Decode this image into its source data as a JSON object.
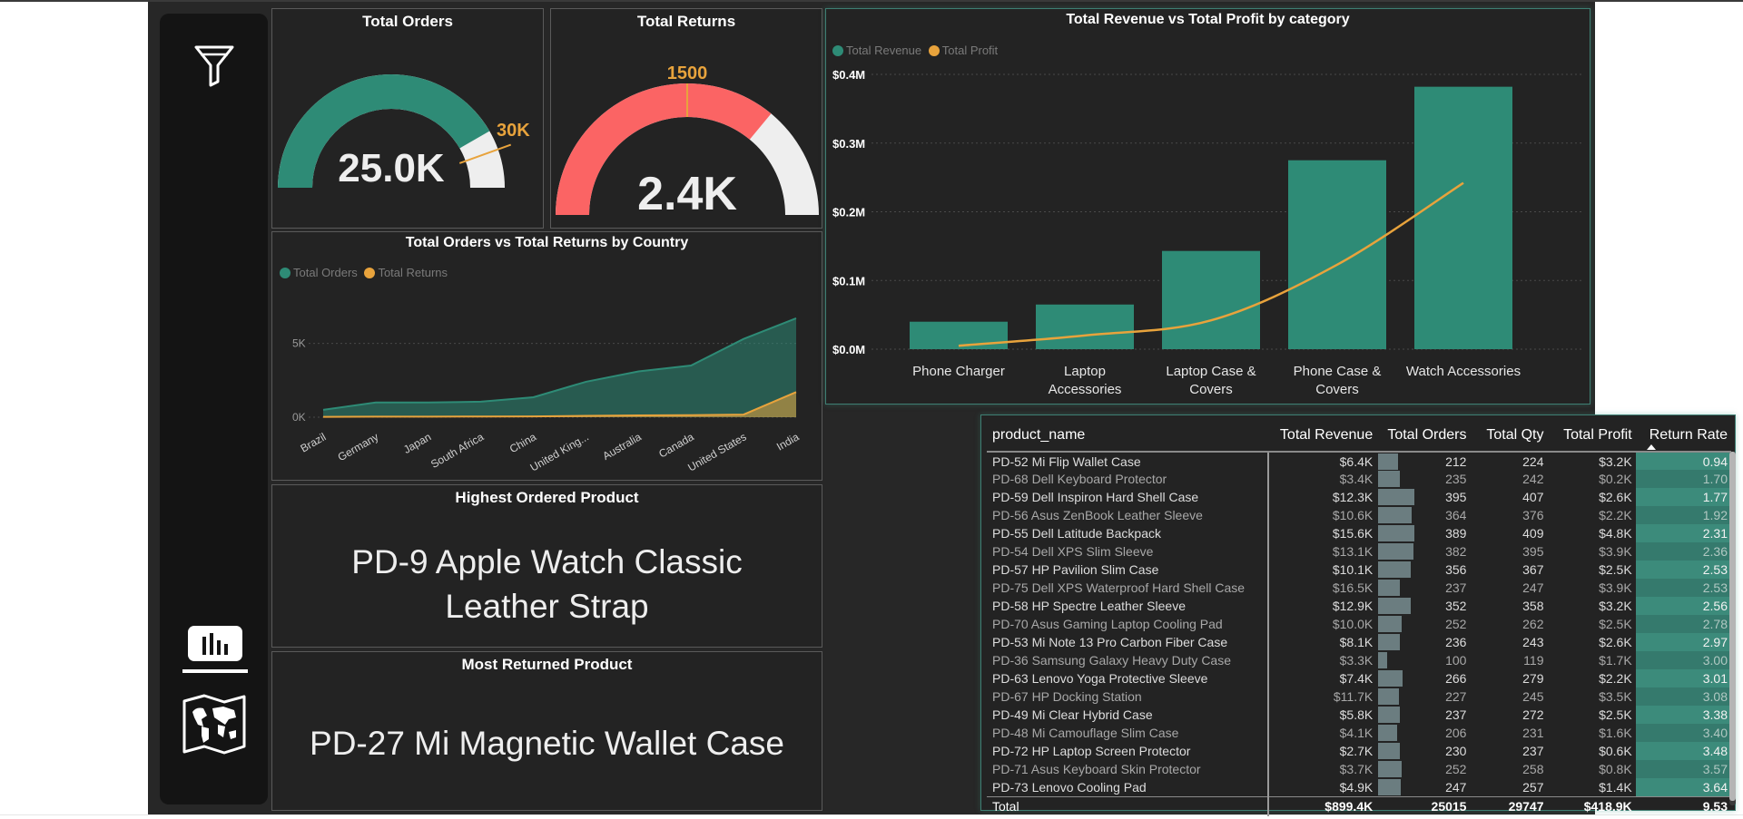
{
  "cards": {
    "total_orders": {
      "title": "Total Orders",
      "value": "25.0K",
      "target_label": "30K",
      "fraction": 0.8333,
      "target_fraction": 1.0
    },
    "total_returns": {
      "title": "Total Returns",
      "value": "2.4K",
      "target_label": "1500",
      "fraction": 0.72,
      "target_fraction": 0.5
    }
  },
  "country_chart": {
    "title": "Total Orders vs Total Returns by Country",
    "legend": [
      "Total Orders",
      "Total Returns"
    ],
    "colors": {
      "orders": "#2e8b76",
      "returns": "#e8a33c"
    },
    "y_ticks": [
      "5K",
      "0K"
    ],
    "y_tick_values": [
      5000,
      0
    ],
    "ylim": [
      0,
      7000
    ]
  },
  "category_chart": {
    "title": "Total Revenue vs Total Profit by category",
    "legend": [
      "Total Revenue",
      "Total Profit"
    ],
    "colors": {
      "revenue": "#2e8b76",
      "profit": "#e8a33c"
    },
    "y_ticks": [
      "$0.4M",
      "$0.3M",
      "$0.2M",
      "$0.1M",
      "$0.0M"
    ],
    "y_tick_values": [
      400000,
      300000,
      200000,
      100000,
      0
    ],
    "ylim": [
      0,
      400000
    ]
  },
  "chart_data": [
    {
      "type": "area",
      "title": "Total Orders vs Total Returns by Country",
      "xlabel": "",
      "ylabel": "",
      "categories": [
        "Brazil",
        "Germany",
        "Japan",
        "South Africa",
        "China",
        "United King...",
        "Australia",
        "Canada",
        "United States",
        "India"
      ],
      "series": [
        {
          "name": "Total Orders",
          "values": [
            500,
            1000,
            1000,
            1050,
            1350,
            2400,
            3100,
            3500,
            5300,
            6700
          ]
        },
        {
          "name": "Total Returns",
          "values": [
            20,
            40,
            40,
            45,
            55,
            90,
            120,
            140,
            180,
            1700
          ]
        }
      ],
      "ylim": [
        0,
        7000
      ],
      "grid": true,
      "legend_position": "top-left"
    },
    {
      "type": "bar",
      "title": "Total Revenue vs Total Profit by category",
      "xlabel": "",
      "ylabel": "",
      "categories": [
        "Phone Charger",
        "Laptop Accessories",
        "Laptop Case & Covers",
        "Phone Case & Covers",
        "Watch Accessories"
      ],
      "series": [
        {
          "name": "Total Revenue",
          "type": "bar",
          "values": [
            40000,
            65000,
            143000,
            275000,
            382000
          ]
        },
        {
          "name": "Total Profit",
          "type": "line",
          "values": [
            5000,
            20000,
            42000,
            123000,
            242000
          ]
        }
      ],
      "ylim": [
        0,
        400000
      ],
      "grid": true,
      "legend_position": "top-left"
    }
  ],
  "highest_product": {
    "title": "Highest Ordered Product",
    "line1": "PD-9  Apple Watch Classic",
    "line2": "Leather Strap"
  },
  "most_returned": {
    "title": "Most Returned Product",
    "text": "PD-27  Mi Magnetic Wallet Case"
  },
  "table": {
    "columns": [
      "product_name",
      "Total Revenue",
      "Total Orders",
      "Total Qty",
      "Total Profit",
      "Return Rate"
    ],
    "sorted_column": "Return Rate",
    "max_orders": 395,
    "rows": [
      [
        "PD-52  Mi Flip Wallet Case",
        "$6.4K",
        "212",
        "224",
        "$3.2K",
        "0.94"
      ],
      [
        "PD-68  Dell Keyboard Protector",
        "$3.4K",
        "235",
        "242",
        "$0.2K",
        "1.70"
      ],
      [
        "PD-59  Dell Inspiron Hard Shell Case",
        "$12.3K",
        "395",
        "407",
        "$2.6K",
        "1.77"
      ],
      [
        "PD-56  Asus ZenBook Leather Sleeve",
        "$10.6K",
        "364",
        "376",
        "$2.2K",
        "1.92"
      ],
      [
        "PD-55  Dell Latitude Backpack",
        "$15.6K",
        "389",
        "409",
        "$4.8K",
        "2.31"
      ],
      [
        "PD-54  Dell XPS Slim Sleeve",
        "$13.1K",
        "382",
        "395",
        "$3.9K",
        "2.36"
      ],
      [
        "PD-57  HP Pavilion Slim Case",
        "$10.1K",
        "356",
        "367",
        "$2.5K",
        "2.53"
      ],
      [
        "PD-75  Dell XPS Waterproof Hard Shell Case",
        "$16.5K",
        "237",
        "247",
        "$3.9K",
        "2.53"
      ],
      [
        "PD-58  HP Spectre Leather Sleeve",
        "$12.9K",
        "352",
        "358",
        "$3.2K",
        "2.56"
      ],
      [
        "PD-70  Asus Gaming Laptop Cooling Pad",
        "$10.0K",
        "252",
        "262",
        "$2.5K",
        "2.78"
      ],
      [
        "PD-53  Mi Note 13 Pro Carbon Fiber Case",
        "$8.1K",
        "236",
        "243",
        "$2.6K",
        "2.97"
      ],
      [
        "PD-36  Samsung Galaxy Heavy Duty Case",
        "$3.3K",
        "100",
        "119",
        "$1.7K",
        "3.00"
      ],
      [
        "PD-63  Lenovo Yoga Protective Sleeve",
        "$7.4K",
        "266",
        "279",
        "$2.2K",
        "3.01"
      ],
      [
        "PD-67  HP Docking Station",
        "$11.7K",
        "227",
        "245",
        "$3.5K",
        "3.08"
      ],
      [
        "PD-49  Mi Clear Hybrid Case",
        "$5.8K",
        "237",
        "272",
        "$2.5K",
        "3.38"
      ],
      [
        "PD-48  Mi Camouflage Slim Case",
        "$4.1K",
        "206",
        "231",
        "$1.6K",
        "3.40"
      ],
      [
        "PD-72  HP Laptop Screen Protector",
        "$2.7K",
        "230",
        "237",
        "$0.6K",
        "3.48"
      ],
      [
        "PD-71  Asus Keyboard Skin Protector",
        "$3.7K",
        "252",
        "258",
        "$0.8K",
        "3.57"
      ],
      [
        "PD-73  Lenovo Cooling Pad",
        "$4.9K",
        "247",
        "257",
        "$1.4K",
        "3.64"
      ]
    ],
    "total": [
      "Total",
      "$899.4K",
      "25015",
      "29747",
      "$418.9K",
      "9.53"
    ]
  },
  "sidebar": {
    "icons": [
      "filter-icon",
      "bar-chart-icon",
      "world-map-icon"
    ]
  }
}
